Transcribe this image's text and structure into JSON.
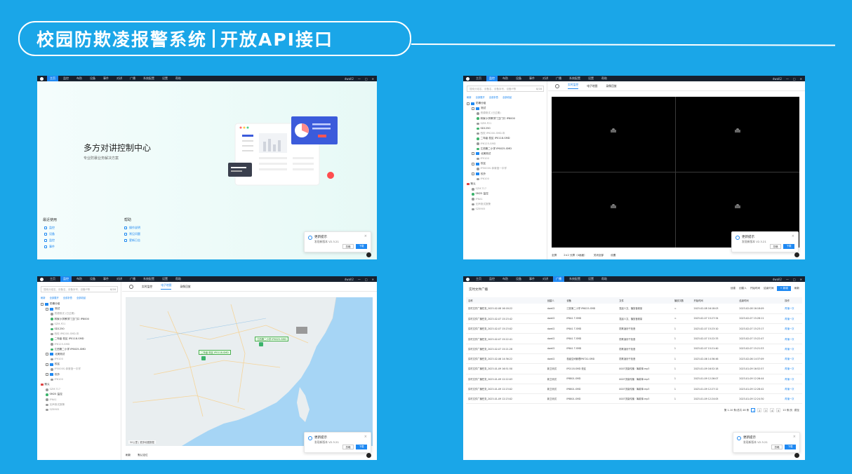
{
  "banner": {
    "title_left": "校园防欺凌报警系统",
    "title_right": "开放API接口"
  },
  "nav": {
    "tabs": [
      "主页",
      "监控",
      "布防",
      "设备",
      "事件",
      "对讲",
      "广播",
      "系统配置",
      "设置",
      "帮助"
    ],
    "user": "dwall2",
    "controls": [
      "—",
      "□",
      "✕"
    ]
  },
  "home": {
    "hero_title": "多方对讲控制中心",
    "hero_sub": "专业防暴业务解决方案",
    "recent_title": "最近使用",
    "recent_items": [
      "监控",
      "设备",
      "监控",
      "事件"
    ],
    "help_title": "帮助",
    "help_items": [
      "操作说明",
      "常见问题",
      "更新日志"
    ]
  },
  "notify": {
    "title": "更新提示",
    "message": "发现新版本 V2.3.21",
    "later": "忽略",
    "download": "下载"
  },
  "tree": {
    "search_placeholder": "搜索分组名、设备名、设备序号、设备IP等",
    "count": "8/16",
    "tools": [
      "刷新",
      "全部展开",
      "全部折叠",
      "全部收起"
    ],
    "nodes": [
      {
        "level": 0,
        "type": "folder",
        "label": "防暴分组"
      },
      {
        "level": 1,
        "type": "folder",
        "label": "测试"
      },
      {
        "level": 2,
        "type": "dev",
        "label": "资源测试 (已过期)",
        "grey": true
      },
      {
        "level": 2,
        "type": "dev",
        "label": "林家小学教学门卫门口 IP8000"
      },
      {
        "level": 2,
        "type": "dev",
        "label": "SZM-P21",
        "grey": true
      },
      {
        "level": 2,
        "type": "dev",
        "label": "SD1250"
      },
      {
        "level": 2,
        "type": "dev",
        "label": "西校 IP6200-SMD-年",
        "grey": true
      },
      {
        "level": 2,
        "type": "dev",
        "label": "二年级 校区 IP0118-SMD"
      },
      {
        "level": 2,
        "type": "dev",
        "label": "IP6125-SMD",
        "grey": true
      },
      {
        "level": 2,
        "type": "dev",
        "label": "江西第二小学 IP6025-SMD"
      },
      {
        "level": 1,
        "type": "folder",
        "label": "北美测试"
      },
      {
        "level": 2,
        "type": "dev",
        "label": "IP9100",
        "grey": true
      },
      {
        "level": 1,
        "type": "folder",
        "label": "校区"
      },
      {
        "level": 2,
        "type": "dev",
        "label": "IP5000S-体育馆一中学",
        "grey": true
      },
      {
        "level": 1,
        "type": "folder",
        "label": "校外"
      },
      {
        "level": 2,
        "type": "dev",
        "label": "IP6100",
        "grey": true
      },
      {
        "level": 0,
        "type": "red",
        "label": "默认"
      },
      {
        "level": 1,
        "type": "dev",
        "label": "SZM-T17",
        "grey": true
      },
      {
        "level": 1,
        "type": "dev",
        "label": "SM25 监控"
      },
      {
        "level": 1,
        "type": "dev",
        "label": "IP6A1",
        "grey": true
      },
      {
        "level": 1,
        "type": "dev",
        "label": "无声测试报警",
        "grey": true
      },
      {
        "level": 1,
        "type": "dev",
        "label": "SZ8905",
        "grey": true
      }
    ],
    "side_link": "更多"
  },
  "monitor": {
    "tabs": [
      "实时监控",
      "电子地图",
      "录像回放"
    ],
    "bar": [
      "全屏",
      "2×2 分屏（4画面）",
      "关闭全部",
      "设置"
    ]
  },
  "map": {
    "bar": [
      "刷新",
      "默认定位"
    ],
    "labels": [
      "江西第二小学 IP6025-SMD",
      "二年级 校区 IP0118-SMD"
    ],
    "scale": "50公里 | 更多地图数据"
  },
  "broadcast": {
    "title": "实时文件广播",
    "filters": [
      "创建",
      "创建人",
      "开始时间",
      "结束时间"
    ],
    "add": "+ 新增",
    "refresh": "刷新",
    "headers": [
      "名称",
      "创建人",
      "设备",
      "文件",
      "播放次数",
      "开始时间",
      "结束时间",
      "操作"
    ],
    "rows": [
      [
        "实时文件广播任务_2023-02-08 16:18:22",
        "dwall2",
        "江西第二小学 IP6025-SMD",
        "发起人文、播放音频量",
        "∞",
        "2023-02-08 16:18:03",
        "2023-02-08 16:18:09",
        "再播一次"
      ],
      [
        "实时文件广播任务_2023-02-07 15:23:42",
        "dwall2",
        "IP6A1 T-SMD",
        "发起人文、播放音频量",
        "∞",
        "2023-02-07 15:27:34",
        "2023-02-07 15:28:11",
        "再播一次"
      ],
      [
        "实时文件广播任务_2023-02-07 15:23:02",
        "dwall2",
        "IP6A1 T-SMD",
        "防欺凌铃干扰音",
        "1",
        "2023-02-07 15:23:10",
        "2023-02-07 15:23:17",
        "再播一次"
      ],
      [
        "实时文件广播任务_2023-02-07 15:22:41",
        "dwall2",
        "IP6A1 T-SMD",
        "防欺凌铃干扰音",
        "1",
        "2023-02-07 15:22:33",
        "2023-02-07 15:22:47",
        "再播一次"
      ],
      [
        "实时文件广播任务_2023-02-07 15:21:28",
        "dwall2",
        "IP6A1 T-SMD",
        "防欺凌铃干扰音",
        "1",
        "2023-02-07 15:21:40",
        "2023-02-07 15:21:53",
        "再播一次"
      ],
      [
        "实时文件广播任务_2023-02-06 14:36:22",
        "dwall2",
        "校级空间管理IP6720-SMD",
        "防欺凌铃干扰音",
        "1",
        "2023-02-06 14:36:46",
        "2023-02-06 14:37:09",
        "再播一次"
      ],
      [
        "实时文件广播任务_2023-01-09 16:51:50",
        "新卫测试",
        "IP0118-SMD 校区",
        "0007流量传播 · 筹款单.mp3",
        "1",
        "2023-01-09 16:52:18",
        "2023-01-09 16:52:57",
        "再播一次"
      ],
      [
        "实时文件广播任务_2023-01-09 12:22:03",
        "新卫测试",
        "IP6801-SMD",
        "0007流量传播 · 筹款单.mp3",
        "1",
        "2023-01-09 12:26:07",
        "2023-01-09 12:26:44",
        "再播一次"
      ],
      [
        "实时文件广播任务_2023-01-09 12:23:02",
        "新卫测试",
        "IP6801-SMD",
        "0007流量传播 · 筹款单.mp3",
        "1",
        "2023-01-09 12:27:12",
        "2023-01-09 12:28:42",
        "再播一次"
      ],
      [
        "实时文件广播任务_2023-01-09 12:23:02",
        "新卫测试",
        "IP6801-SMD",
        "0007流量传播 · 筹款单.mp3",
        "1",
        "2023-01-09 12:24:05",
        "2023-01-09 12:24:30",
        "再播一次"
      ]
    ],
    "pager_info": "第 1-10 条/总共 48 条",
    "pages": [
      "1",
      "2",
      "3",
      "4",
      "5"
    ],
    "page_size": "10 条/页",
    "goto": "跳至"
  }
}
